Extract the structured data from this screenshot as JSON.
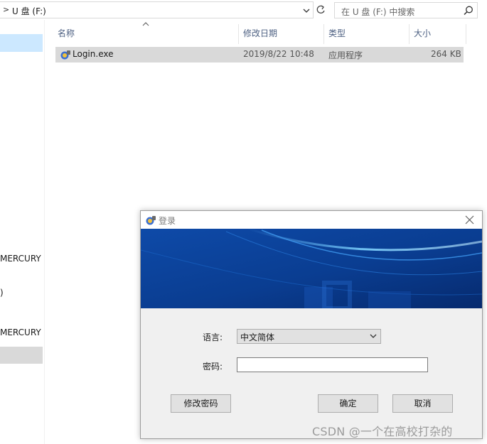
{
  "explorer": {
    "address": {
      "separator": ">",
      "path": "U 盘 (F:)"
    },
    "search": {
      "placeholder": "在 U 盘 (F:) 中搜索",
      "icon": "search-icon"
    },
    "nav": {
      "items": [
        {
          "label": "MERCURY"
        },
        {
          "label": ")"
        },
        {
          "label": "MERCURY"
        }
      ]
    },
    "columns": [
      {
        "label": "名称"
      },
      {
        "label": "修改日期"
      },
      {
        "label": "类型"
      },
      {
        "label": "大小"
      }
    ],
    "files": [
      {
        "name": "Login.exe",
        "modified": "2019/8/22 10:48",
        "type": "应用程序",
        "size": "264 KB"
      }
    ]
  },
  "dialog": {
    "title": "登录",
    "language_label": "语言:",
    "language_value": "中文简体",
    "password_label": "密码:",
    "password_value": "",
    "buttons": {
      "change_password": "修改密码",
      "ok": "确定",
      "cancel": "取消"
    },
    "colors": {
      "banner_dark": "#0a3d91",
      "banner_light": "#1e7fe0",
      "selection": "#cce8ff"
    }
  },
  "watermark": "CSDN @一个在高校打杂的"
}
